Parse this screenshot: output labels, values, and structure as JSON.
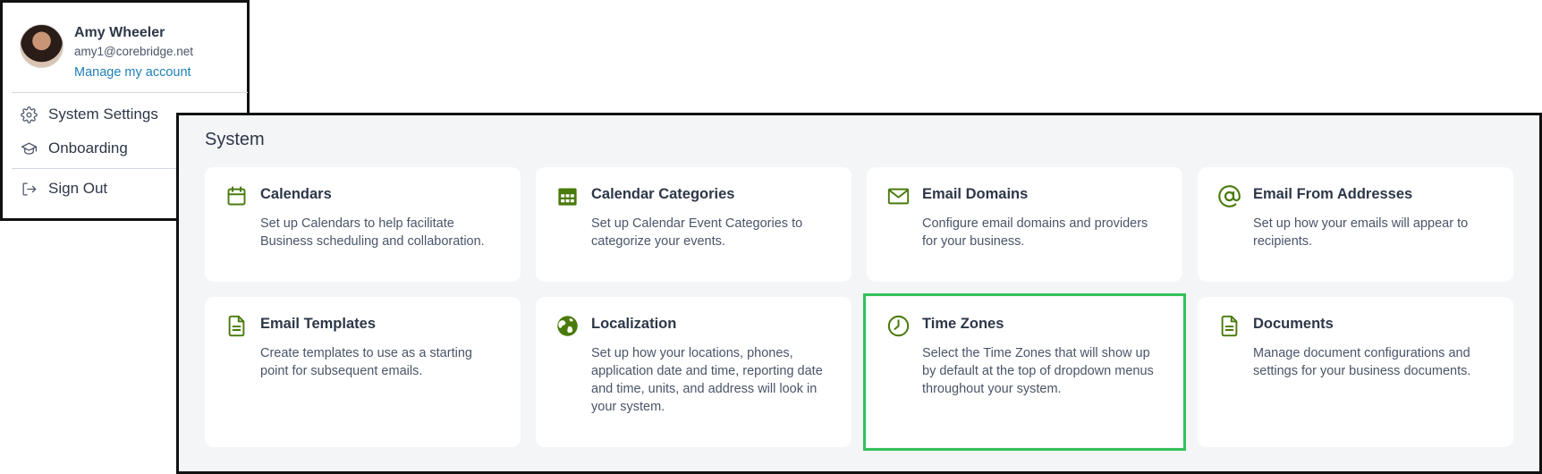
{
  "account": {
    "name": "Amy Wheeler",
    "email": "amy1@corebridge.net",
    "manage_link": "Manage my account",
    "menu": [
      {
        "label": "System Settings",
        "icon": "gear-icon"
      },
      {
        "label": "Onboarding",
        "icon": "graduation-cap-icon"
      },
      {
        "label": "Sign Out",
        "icon": "sign-out-icon"
      }
    ]
  },
  "system": {
    "title": "System",
    "accent_color": "#4a7a0c",
    "highlight_color": "#34c15a",
    "highlighted_card": "Time Zones",
    "cards": [
      {
        "title": "Calendars",
        "description": "Set up Calendars to help facilitate Business scheduling and collaboration.",
        "icon": "calendar-icon"
      },
      {
        "title": "Calendar Categories",
        "description": "Set up Calendar Event Categories to categorize your events.",
        "icon": "calendar-grid-icon"
      },
      {
        "title": "Email Domains",
        "description": "Configure email domains and providers for your business.",
        "icon": "envelope-icon"
      },
      {
        "title": "Email From Addresses",
        "description": "Set up how your emails will appear to recipients.",
        "icon": "at-sign-icon"
      },
      {
        "title": "Email Templates",
        "description": "Create templates to use as a starting point for subsequent emails.",
        "icon": "document-icon"
      },
      {
        "title": "Localization",
        "description": "Set up how your locations, phones, application date and time, reporting date and time, units, and address will look in your system.",
        "icon": "globe-icon"
      },
      {
        "title": "Time Zones",
        "description": "Select the Time Zones that will show up by default at the top of dropdown menus throughout your system.",
        "icon": "clock-icon"
      },
      {
        "title": "Documents",
        "description": "Manage document configurations and settings for your business documents.",
        "icon": "document-icon"
      }
    ]
  }
}
